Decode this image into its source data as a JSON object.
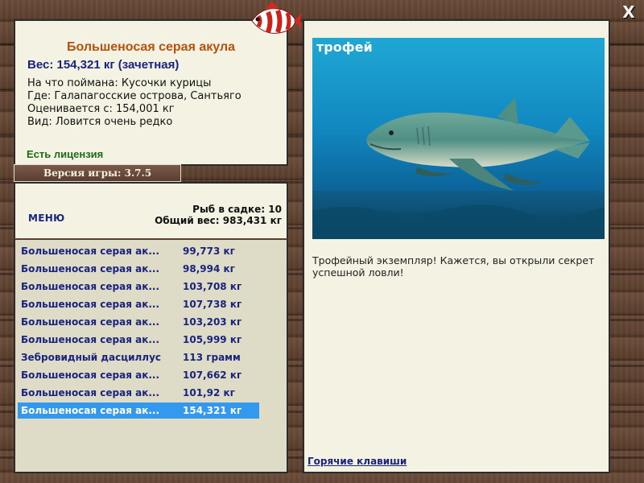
{
  "info": {
    "fish_name": "Большеносая серая акула",
    "weight_line": "Вес: 154,321 кг (зачетная)",
    "bait_line": "На что поймана: Кусочки курицы",
    "location_line": "Где: Галапагосские острова, Сантьяго",
    "rated_line": "Оценивается с: 154,001 кг",
    "rarity_line": "Вид: Ловится очень редко",
    "license": "Есть лицензия"
  },
  "version": "Версия игры: 3.7.5",
  "stats": {
    "menu_label": "МЕНЮ",
    "fish_count": "Рыб в садке: 10",
    "total_weight": "Общий вес: 983,431 кг"
  },
  "catch_list": [
    {
      "name": "Большеносая серая ак...",
      "weight": "99,773 кг"
    },
    {
      "name": "Большеносая серая ак...",
      "weight": "98,994 кг"
    },
    {
      "name": "Большеносая серая ак...",
      "weight": "103,708 кг"
    },
    {
      "name": "Большеносая серая ак...",
      "weight": "107,738 кг"
    },
    {
      "name": "Большеносая серая ак...",
      "weight": "103,203 кг"
    },
    {
      "name": "Большеносая серая ак...",
      "weight": "105,999 кг"
    },
    {
      "name": "Зебровидный дасциллус",
      "weight": "113 грамм"
    },
    {
      "name": "Большеносая серая ак...",
      "weight": "107,662 кг"
    },
    {
      "name": "Большеносая серая ак...",
      "weight": "101,92 кг"
    },
    {
      "name": "Большеносая серая ак...",
      "weight": "154,321 кг"
    }
  ],
  "selected_index": 9,
  "trophy": {
    "label": "трофей",
    "text": "Трофейный экземпляр! Кажется, вы открыли секрет успешной ловли!"
  },
  "hotkeys_label": "Горячие клавиши",
  "close_label": "X",
  "colors": {
    "title": "#b5520d",
    "accent_blue": "#1a237e",
    "license_green": "#1b6b1b",
    "selection": "#3399ee"
  },
  "icons": {
    "logo": "striped-fish-icon",
    "close": "close-icon"
  }
}
